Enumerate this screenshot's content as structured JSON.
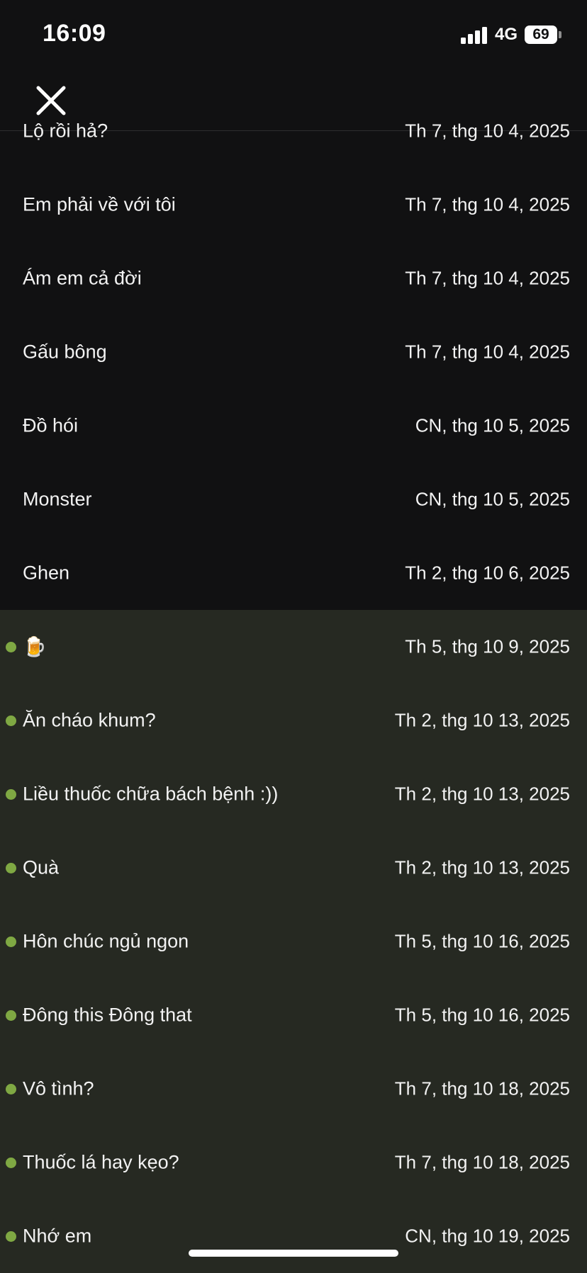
{
  "status_bar": {
    "time": "16:09",
    "network": "4G",
    "battery": "69",
    "signal_icon": "cellular-signal-icon",
    "battery_icon": "battery-icon"
  },
  "header": {
    "close_icon": "close-icon"
  },
  "colors": {
    "background": "#111112",
    "unread_background": "#262922",
    "unread_dot": "#7fa843",
    "text": "#f2f2f2"
  },
  "entries": [
    {
      "title": "Lộ rồi hả?",
      "date": "Th 7, thg 10 4, 2025",
      "unread": false
    },
    {
      "title": "Em phải về với tôi",
      "date": "Th 7, thg 10 4, 2025",
      "unread": false
    },
    {
      "title": "Ám em cả đời",
      "date": "Th 7, thg 10 4, 2025",
      "unread": false
    },
    {
      "title": "Gấu bông",
      "date": "Th 7, thg 10 4, 2025",
      "unread": false
    },
    {
      "title": "Đồ hói",
      "date": "CN, thg 10 5, 2025",
      "unread": false
    },
    {
      "title": "Monster",
      "date": "CN, thg 10 5, 2025",
      "unread": false
    },
    {
      "title": "Ghen",
      "date": "Th 2, thg 10 6, 2025",
      "unread": false
    },
    {
      "title": "🍺",
      "date": "Th 5, thg 10 9, 2025",
      "unread": true
    },
    {
      "title": "Ăn cháo khum?",
      "date": "Th 2, thg 10 13, 2025",
      "unread": true
    },
    {
      "title": "Liều thuốc chữa bách bệnh :))",
      "date": "Th 2, thg 10 13, 2025",
      "unread": true
    },
    {
      "title": "Quà",
      "date": "Th 2, thg 10 13, 2025",
      "unread": true
    },
    {
      "title": "Hôn chúc ngủ ngon",
      "date": "Th 5, thg 10 16, 2025",
      "unread": true
    },
    {
      "title": "Đông this Đông that",
      "date": "Th 5, thg 10 16, 2025",
      "unread": true
    },
    {
      "title": "Vô tình?",
      "date": "Th 7, thg 10 18, 2025",
      "unread": true
    },
    {
      "title": "Thuốc lá hay kẹo?",
      "date": "Th 7, thg 10 18, 2025",
      "unread": true
    },
    {
      "title": "Nhớ em",
      "date": "CN, thg 10 19, 2025",
      "unread": true
    }
  ]
}
